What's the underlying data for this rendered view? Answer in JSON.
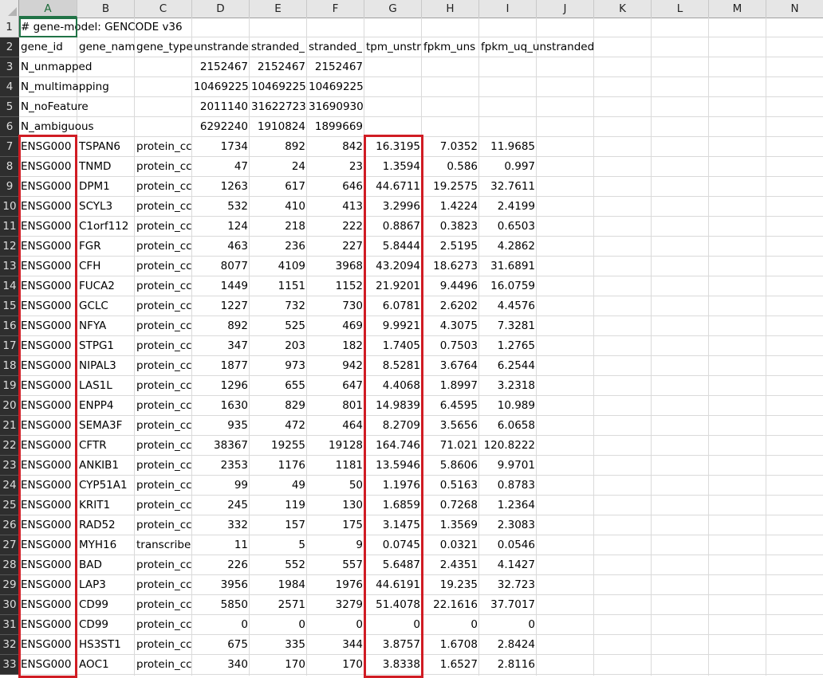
{
  "columns": [
    "A",
    "B",
    "C",
    "D",
    "E",
    "F",
    "G",
    "H",
    "I",
    "J",
    "K",
    "L",
    "M",
    "N"
  ],
  "selected_column": "A",
  "row_numbers": [
    "1",
    "2",
    "3",
    "4",
    "5",
    "6",
    "7",
    "8",
    "9",
    "10",
    "11",
    "12",
    "13",
    "14",
    "15",
    "16",
    "17",
    "18",
    "19",
    "20",
    "21",
    "22",
    "23",
    "24",
    "25",
    "26",
    "27",
    "28",
    "29",
    "30",
    "31",
    "32",
    "33"
  ],
  "row1": {
    "A": "# gene-model: GENCODE v36"
  },
  "headers": [
    "gene_id",
    "gene_nam",
    "gene_type",
    "unstrande",
    "stranded_",
    "stranded_",
    "tpm_unstr",
    "fpkm_uns",
    "fpkm_uq_unstranded"
  ],
  "summary_rows": [
    {
      "A": "N_unmapped",
      "D": "2152467",
      "E": "2152467",
      "F": "2152467"
    },
    {
      "A": "N_multimapping",
      "D": "10469225",
      "E": "10469225",
      "F": "10469225"
    },
    {
      "A": "N_noFeature",
      "D": "2011140",
      "E": "31622723",
      "F": "31690930"
    },
    {
      "A": "N_ambiguous",
      "D": "6292240",
      "E": "1910824",
      "F": "1899669"
    }
  ],
  "gene_rows": [
    [
      "ENSG000",
      "TSPAN6",
      "protein_cc",
      "1734",
      "892",
      "842",
      "16.3195",
      "7.0352",
      "11.9685"
    ],
    [
      "ENSG000",
      "TNMD",
      "protein_cc",
      "47",
      "24",
      "23",
      "1.3594",
      "0.586",
      "0.997"
    ],
    [
      "ENSG000",
      "DPM1",
      "protein_cc",
      "1263",
      "617",
      "646",
      "44.6711",
      "19.2575",
      "32.7611"
    ],
    [
      "ENSG000",
      "SCYL3",
      "protein_cc",
      "532",
      "410",
      "413",
      "3.2996",
      "1.4224",
      "2.4199"
    ],
    [
      "ENSG000",
      "C1orf112",
      "protein_cc",
      "124",
      "218",
      "222",
      "0.8867",
      "0.3823",
      "0.6503"
    ],
    [
      "ENSG000",
      "FGR",
      "protein_cc",
      "463",
      "236",
      "227",
      "5.8444",
      "2.5195",
      "4.2862"
    ],
    [
      "ENSG000",
      "CFH",
      "protein_cc",
      "8077",
      "4109",
      "3968",
      "43.2094",
      "18.6273",
      "31.6891"
    ],
    [
      "ENSG000",
      "FUCA2",
      "protein_cc",
      "1449",
      "1151",
      "1152",
      "21.9201",
      "9.4496",
      "16.0759"
    ],
    [
      "ENSG000",
      "GCLC",
      "protein_cc",
      "1227",
      "732",
      "730",
      "6.0781",
      "2.6202",
      "4.4576"
    ],
    [
      "ENSG000",
      "NFYA",
      "protein_cc",
      "892",
      "525",
      "469",
      "9.9921",
      "4.3075",
      "7.3281"
    ],
    [
      "ENSG000",
      "STPG1",
      "protein_cc",
      "347",
      "203",
      "182",
      "1.7405",
      "0.7503",
      "1.2765"
    ],
    [
      "ENSG000",
      "NIPAL3",
      "protein_cc",
      "1877",
      "973",
      "942",
      "8.5281",
      "3.6764",
      "6.2544"
    ],
    [
      "ENSG000",
      "LAS1L",
      "protein_cc",
      "1296",
      "655",
      "647",
      "4.4068",
      "1.8997",
      "3.2318"
    ],
    [
      "ENSG000",
      "ENPP4",
      "protein_cc",
      "1630",
      "829",
      "801",
      "14.9839",
      "6.4595",
      "10.989"
    ],
    [
      "ENSG000",
      "SEMA3F",
      "protein_cc",
      "935",
      "472",
      "464",
      "8.2709",
      "3.5656",
      "6.0658"
    ],
    [
      "ENSG000",
      "CFTR",
      "protein_cc",
      "38367",
      "19255",
      "19128",
      "164.746",
      "71.021",
      "120.8222"
    ],
    [
      "ENSG000",
      "ANKIB1",
      "protein_cc",
      "2353",
      "1176",
      "1181",
      "13.5946",
      "5.8606",
      "9.9701"
    ],
    [
      "ENSG000",
      "CYP51A1",
      "protein_cc",
      "99",
      "49",
      "50",
      "1.1976",
      "0.5163",
      "0.8783"
    ],
    [
      "ENSG000",
      "KRIT1",
      "protein_cc",
      "245",
      "119",
      "130",
      "1.6859",
      "0.7268",
      "1.2364"
    ],
    [
      "ENSG000",
      "RAD52",
      "protein_cc",
      "332",
      "157",
      "175",
      "3.1475",
      "1.3569",
      "2.3083"
    ],
    [
      "ENSG000",
      "MYH16",
      "transcribe",
      "11",
      "5",
      "9",
      "0.0745",
      "0.0321",
      "0.0546"
    ],
    [
      "ENSG000",
      "BAD",
      "protein_cc",
      "226",
      "552",
      "557",
      "5.6487",
      "2.4351",
      "4.1427"
    ],
    [
      "ENSG000",
      "LAP3",
      "protein_cc",
      "3956",
      "1984",
      "1976",
      "44.6191",
      "19.235",
      "32.723"
    ],
    [
      "ENSG000",
      "CD99",
      "protein_cc",
      "5850",
      "2571",
      "3279",
      "51.4078",
      "22.1616",
      "37.7017"
    ],
    [
      "ENSG000",
      "CD99",
      "protein_cc",
      "0",
      "0",
      "0",
      "0",
      "0",
      "0"
    ],
    [
      "ENSG000",
      "HS3ST1",
      "protein_cc",
      "675",
      "335",
      "344",
      "3.8757",
      "1.6708",
      "2.8424"
    ],
    [
      "ENSG000",
      "AOC1",
      "protein_cc",
      "340",
      "170",
      "170",
      "3.8338",
      "1.6527",
      "2.8116"
    ]
  ],
  "colors": {
    "highlight": "#d01c24",
    "selection": "#217346"
  }
}
